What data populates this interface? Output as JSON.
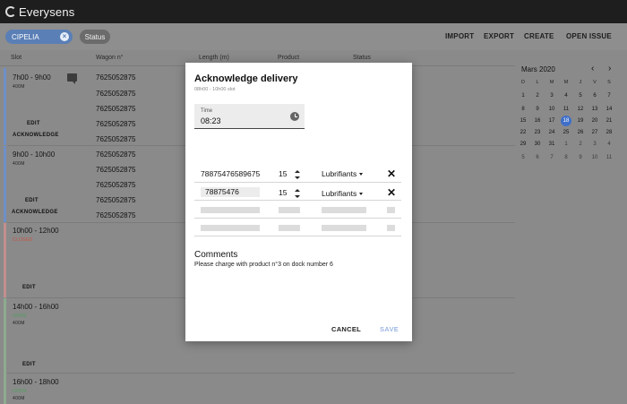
{
  "app": {
    "brand": "Everysens"
  },
  "toolbar": {
    "filter_chip": "CIPELIA",
    "status_chip": "Status",
    "import": "IMPORT",
    "export": "EXPORT",
    "create": "CREATE",
    "open_issue": "OPEN ISSUE"
  },
  "table": {
    "headers": {
      "slot": "Slot",
      "wagon": "Wagon n°",
      "length": "Length (m)",
      "product": "Product",
      "status": "Status"
    },
    "slots": [
      {
        "time": "7h00 - 9h00",
        "sub": "400M",
        "edit": "EDIT",
        "ack": "ACKNOWLEDGE"
      },
      {
        "time": "9h00 - 10h00",
        "sub": "400M",
        "edit": "EDIT",
        "ack": "ACKNOWLEDGE"
      },
      {
        "time": "10h00 - 12h00",
        "state": "CLOSED",
        "edit": "EDIT"
      },
      {
        "time": "14h00 - 16h00",
        "state": "OPEN",
        "sub": "400M",
        "edit": "EDIT"
      },
      {
        "time": "16h00 - 18h00",
        "state": "OPEN",
        "sub": "400M"
      }
    ],
    "wagons": [
      "7625052875",
      "7625052875",
      "7625052875",
      "7625052875",
      "7625052875",
      "7625052875",
      "7625052875",
      "7625052875",
      "7625052875",
      "7625052875"
    ]
  },
  "calendar": {
    "month": "Mars 2020",
    "weekdays": [
      "D",
      "L",
      "M",
      "M",
      "J",
      "V",
      "S"
    ],
    "weeks": [
      [
        "1",
        "2",
        "3",
        "4",
        "5",
        "6",
        "7"
      ],
      [
        "8",
        "9",
        "10",
        "11",
        "12",
        "13",
        "14"
      ],
      [
        "15",
        "16",
        "17",
        "18",
        "19",
        "20",
        "21"
      ],
      [
        "22",
        "23",
        "24",
        "25",
        "26",
        "27",
        "28"
      ],
      [
        "29",
        "30",
        "31",
        "1",
        "2",
        "3",
        "4"
      ],
      [
        "5",
        "6",
        "7",
        "8",
        "9",
        "10",
        "11"
      ]
    ],
    "selected": "18"
  },
  "dialog": {
    "title": "Acknowledge delivery",
    "subtitle": "08h00 - 10h00 slot",
    "time_label": "Time",
    "time_value": "08:23",
    "lines": [
      {
        "code": "78875476589675",
        "qty": "15",
        "product": "Lubrifiants"
      },
      {
        "code": "78875476",
        "qty": "15",
        "product": "Lubrifiants"
      }
    ],
    "remove_symbol": "✕",
    "comments_title": "Comments",
    "comments_text": "Please charge with product n°3 on dock number 6",
    "cancel": "CANCEL",
    "save": "SAVE"
  },
  "colors": {
    "accent": "#3f6fc8",
    "closed": "#e0604a",
    "open": "#5fae6a",
    "topbar": "#1e1e1e"
  }
}
